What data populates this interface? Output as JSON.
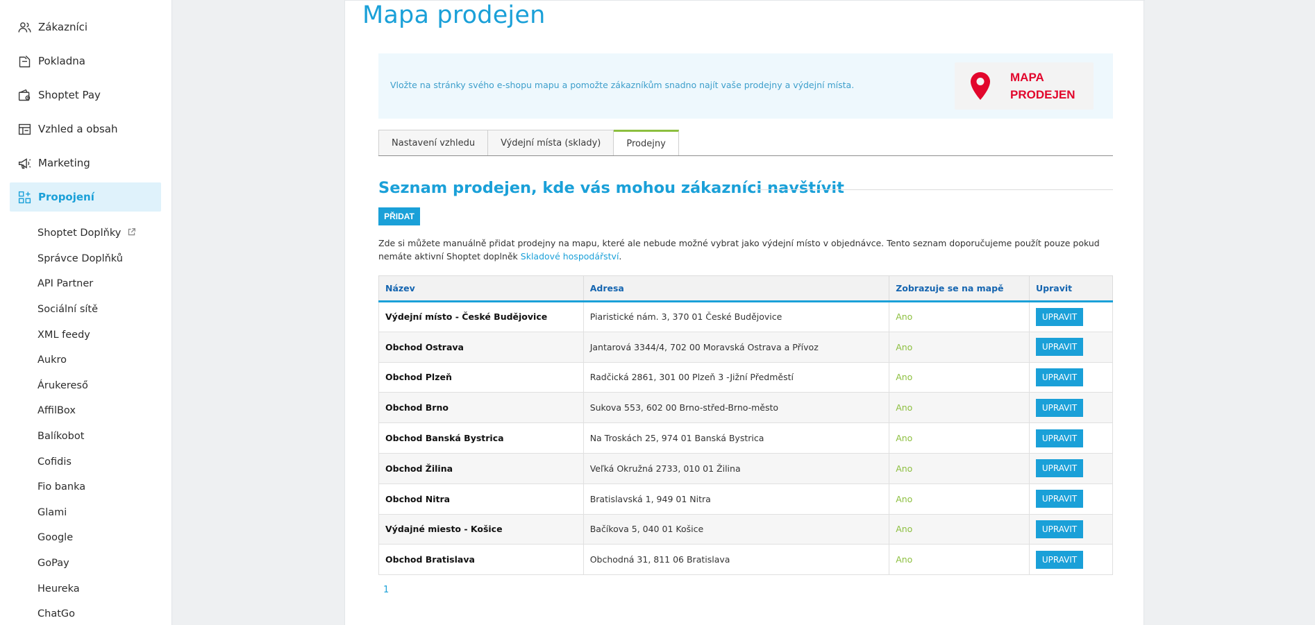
{
  "sidebar": {
    "main_items": [
      {
        "label": "Zákazníci",
        "icon": "users-icon"
      },
      {
        "label": "Pokladna",
        "icon": "cash-register-icon"
      },
      {
        "label": "Shoptet Pay",
        "icon": "wallet-icon"
      },
      {
        "label": "Vzhled a obsah",
        "icon": "layout-icon"
      },
      {
        "label": "Marketing",
        "icon": "megaphone-icon"
      },
      {
        "label": "Propojení",
        "icon": "apps-add-icon",
        "active": true
      }
    ],
    "sub_items": [
      "Shoptet Doplňky",
      "Správce Doplňků",
      "API Partner",
      "Sociální sítě",
      "XML feedy",
      "Aukro",
      "Árukereső",
      "AffilBox",
      "Balíkobot",
      "Cofidis",
      "Fio banka",
      "Glami",
      "Google",
      "GoPay",
      "Heureka",
      "ChatGo"
    ]
  },
  "page": {
    "title": "Mapa prodejen",
    "info_text": "Vložte na stránky svého e-shopu mapu a pomožte zákazníkům snadno najít vaše prodejny a výdejní místa.",
    "logo_line1": "MAPA",
    "logo_line2": "PRODEJEN",
    "brand_color": "#1aa0d8",
    "logo_color": "#e2062c"
  },
  "tabs": [
    {
      "label": "Nastavení vzhledu"
    },
    {
      "label": "Výdejní místa (sklady)"
    },
    {
      "label": "Prodejny",
      "active": true
    }
  ],
  "section": {
    "title": "Seznam prodejen, kde vás mohou zákazníci navštívit",
    "add_label": "PŘIDAT",
    "desc_before": "Zde si můžete manuálně přidat prodejny na mapu, které ale nebude možné vybrat jako výdejní místo v objednávce. Tento seznam doporučujeme použít pouze pokud nemáte aktivní Shoptet doplněk ",
    "desc_link": "Skladové hospodářství",
    "desc_after": "."
  },
  "table": {
    "columns": [
      "Název",
      "Adresa",
      "Zobrazuje se na mapě",
      "Upravit"
    ],
    "edit_label": "UPRAVIT",
    "rows": [
      {
        "name": "Výdejní místo - České Budějovice",
        "address": "Piaristické nám. 3, 370 01 České Budějovice",
        "on_map": "Ano"
      },
      {
        "name": "Obchod Ostrava",
        "address": "Jantarová 3344/4, 702 00 Moravská Ostrava a Přívoz",
        "on_map": "Ano"
      },
      {
        "name": "Obchod Plzeň",
        "address": "Radčická 2861, 301 00 Plzeň 3 -Jižní Předměstí",
        "on_map": "Ano"
      },
      {
        "name": "Obchod Brno",
        "address": "Sukova 553, 602 00 Brno-střed-Brno-město",
        "on_map": "Ano"
      },
      {
        "name": "Obchod Banská Bystrica",
        "address": "Na Troskách 25, 974 01 Banská Bystrica",
        "on_map": "Ano"
      },
      {
        "name": "Obchod Žilina",
        "address": "Veľká Okružná 2733, 010 01 Žilina",
        "on_map": "Ano"
      },
      {
        "name": "Obchod Nitra",
        "address": "Bratislavská 1, 949 01 Nitra",
        "on_map": "Ano"
      },
      {
        "name": "Výdajné miesto - Košice",
        "address": "Bačíkova 5, 040 01 Košice",
        "on_map": "Ano"
      },
      {
        "name": "Obchod Bratislava",
        "address": "Obchodná 31, 811 06 Bratislava",
        "on_map": "Ano"
      }
    ]
  },
  "pagination": {
    "current": "1"
  }
}
